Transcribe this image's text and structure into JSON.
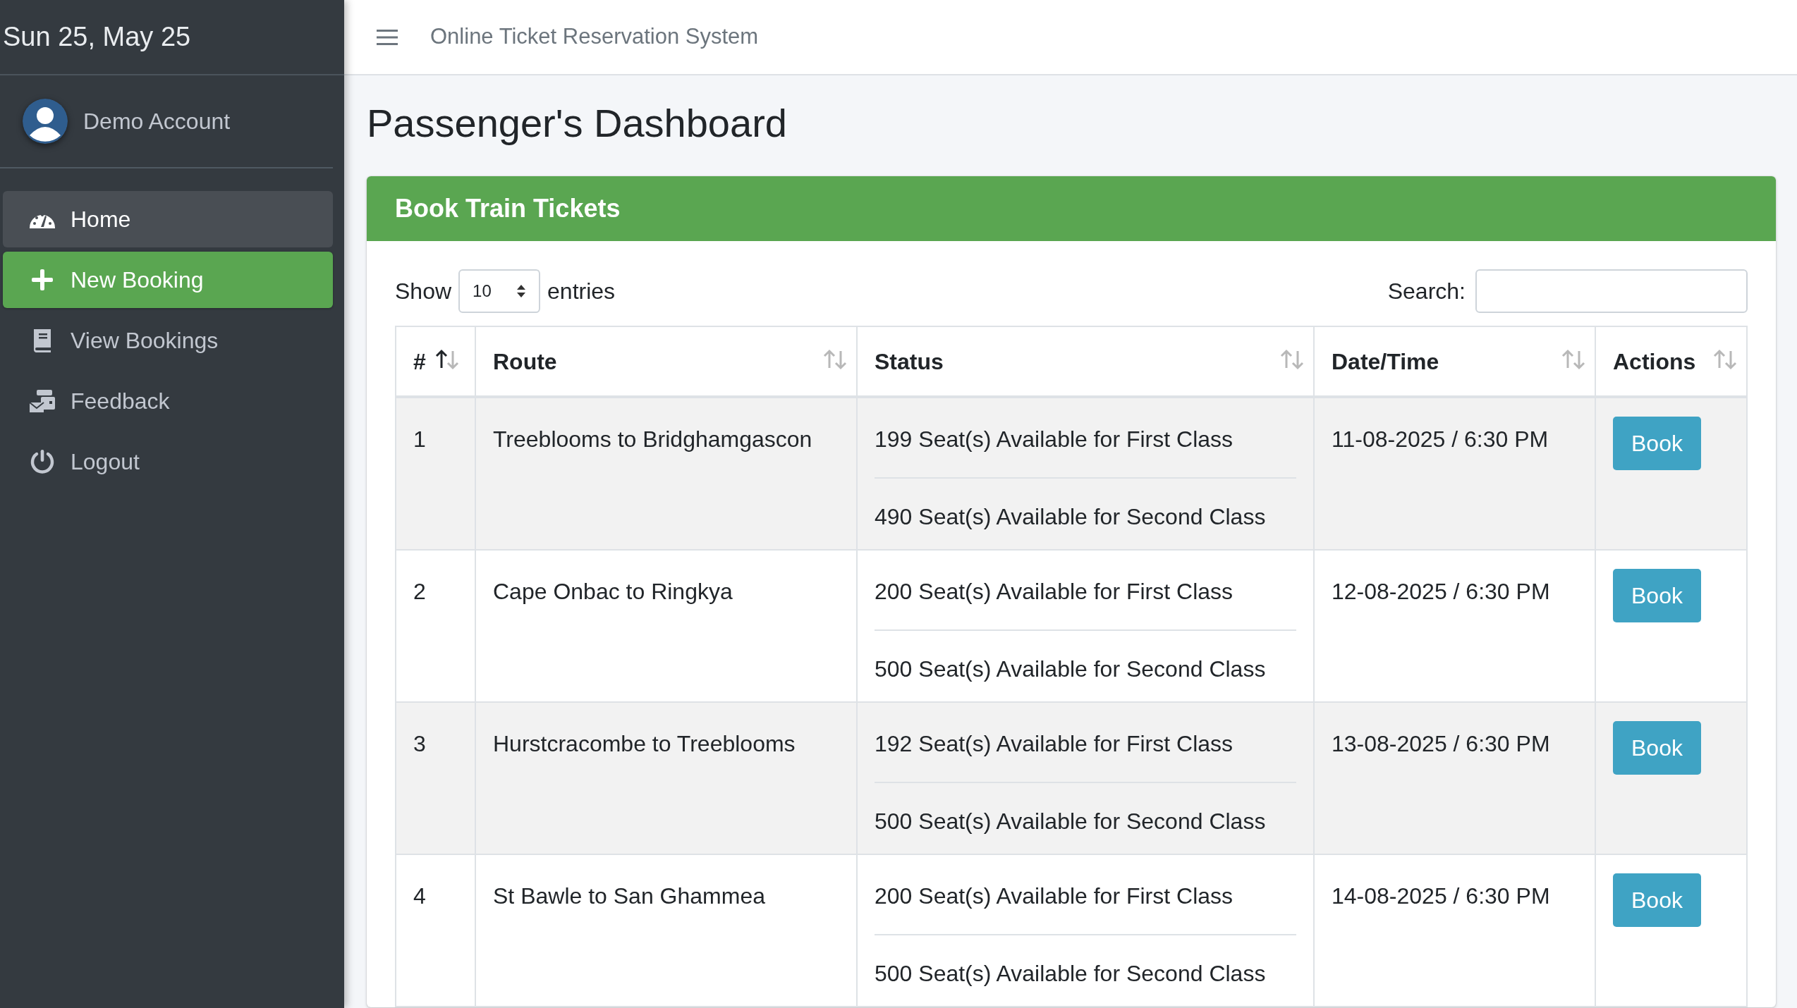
{
  "sidebar": {
    "date": "Sun 25, May 25",
    "user": "Demo Account",
    "items": [
      {
        "label": "Home",
        "selected": false,
        "highlighted": true
      },
      {
        "label": "New Booking",
        "selected": true,
        "highlighted": false
      },
      {
        "label": "View Bookings",
        "selected": false,
        "highlighted": false
      },
      {
        "label": "Feedback",
        "selected": false,
        "highlighted": false
      },
      {
        "label": "Logout",
        "selected": false,
        "highlighted": false
      }
    ]
  },
  "topbar": {
    "title": "Online Ticket Reservation System"
  },
  "page_title": "Passenger's Dashboard",
  "card": {
    "title": "Book Train Tickets",
    "length": {
      "before": "Show",
      "value": "10",
      "after": "entries"
    },
    "search": {
      "label": "Search:"
    },
    "table": {
      "columns": [
        {
          "label": "#",
          "sorted_ascending": true
        },
        {
          "label": "Route",
          "sorted_ascending": false
        },
        {
          "label": "Status",
          "sorted_ascending": false
        },
        {
          "label": "Date/Time",
          "sorted_ascending": false
        },
        {
          "label": "Actions",
          "sorted_ascending": false
        }
      ],
      "rows": [
        {
          "no": "1",
          "route": "Treeblooms to Bridghamgascon",
          "status": [
            "199 Seat(s) Available for First Class",
            "490 Seat(s) Available for Second Class"
          ],
          "datetime": "11-08-2025 / 6:30 PM",
          "action": "Book"
        },
        {
          "no": "2",
          "route": "Cape Onbac to Ringkya",
          "status": [
            "200 Seat(s) Available for First Class",
            "500 Seat(s) Available for Second Class"
          ],
          "datetime": "12-08-2025 / 6:30 PM",
          "action": "Book"
        },
        {
          "no": "3",
          "route": "Hurstcracombe to Treeblooms",
          "status": [
            "192 Seat(s) Available for First Class",
            "500 Seat(s) Available for Second Class"
          ],
          "datetime": "13-08-2025 / 6:30 PM",
          "action": "Book"
        },
        {
          "no": "4",
          "route": "St Bawle to San Ghammea",
          "status": [
            "200 Seat(s) Available for First Class",
            "500 Seat(s) Available for Second Class"
          ],
          "datetime": "14-08-2025 / 6:30 PM",
          "action": "Book"
        }
      ]
    }
  }
}
